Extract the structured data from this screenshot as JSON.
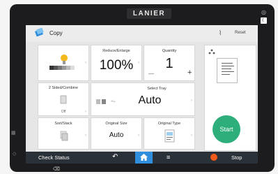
{
  "device": {
    "brand": "LANIER"
  },
  "header": {
    "title": "Copy",
    "reset_label": "Reset"
  },
  "tiles": {
    "density": {
      "label": ""
    },
    "reduce_enlarge": {
      "label": "Reduce/Enlarge",
      "value": "100%"
    },
    "quantity": {
      "label": "Quantity",
      "value": "1",
      "minus": "—",
      "plus": "+"
    },
    "sided": {
      "label": "2 Sided/Combine",
      "status": "Off"
    },
    "tray": {
      "label": "Select Tray",
      "value": "Auto",
      "icon_text": "+LL"
    },
    "sort": {
      "label": "Sort/Stack"
    },
    "original_size": {
      "label": "Original Size",
      "value": "Auto"
    },
    "original_type": {
      "label": "Original Type"
    }
  },
  "actions": {
    "start_label": "Start"
  },
  "bottom": {
    "check_status": "Check Status",
    "stop": "Stop"
  },
  "colors": {
    "accent_green": "#2dae7b",
    "home_blue": "#2f8fdc",
    "stop_orange": "#f05a1a",
    "bar_dark": "#2b3138"
  }
}
